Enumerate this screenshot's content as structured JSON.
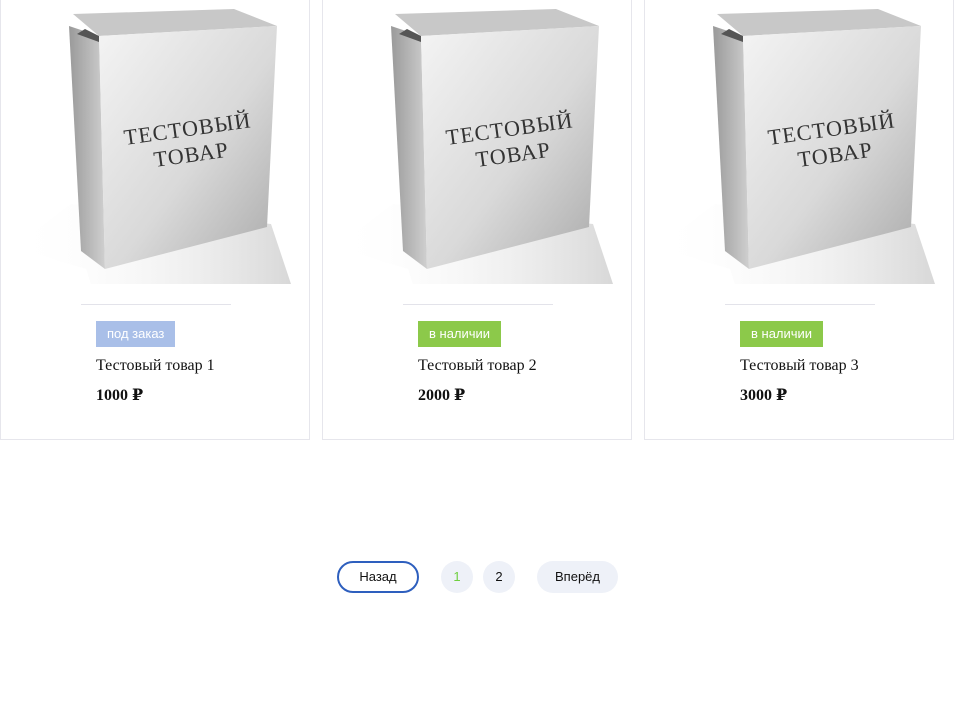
{
  "products": [
    {
      "box_text_line1": "ТЕСТОВЫЙ",
      "box_text_line2": "ТОВАР",
      "badge": "под заказ",
      "badge_color": "#a9bfe8",
      "name": "Тестовый товар 1",
      "price": "1000",
      "currency": "₽"
    },
    {
      "box_text_line1": "ТЕСТОВЫЙ",
      "box_text_line2": "ТОВАР",
      "badge": "в наличии",
      "badge_color": "#8cc94a",
      "name": "Тестовый товар 2",
      "price": "2000",
      "currency": "₽"
    },
    {
      "box_text_line1": "ТЕСТОВЫЙ",
      "box_text_line2": "ТОВАР",
      "badge": "в наличии",
      "badge_color": "#8cc94a",
      "name": "Тестовый товар 3",
      "price": "3000",
      "currency": "₽"
    }
  ],
  "pagination": {
    "prev_label": "Назад",
    "pages": [
      "1",
      "2"
    ],
    "current_page": "1",
    "next_label": "Вперёд",
    "accent_color": "#2e5fbe",
    "current_color": "#6fcf3f"
  }
}
